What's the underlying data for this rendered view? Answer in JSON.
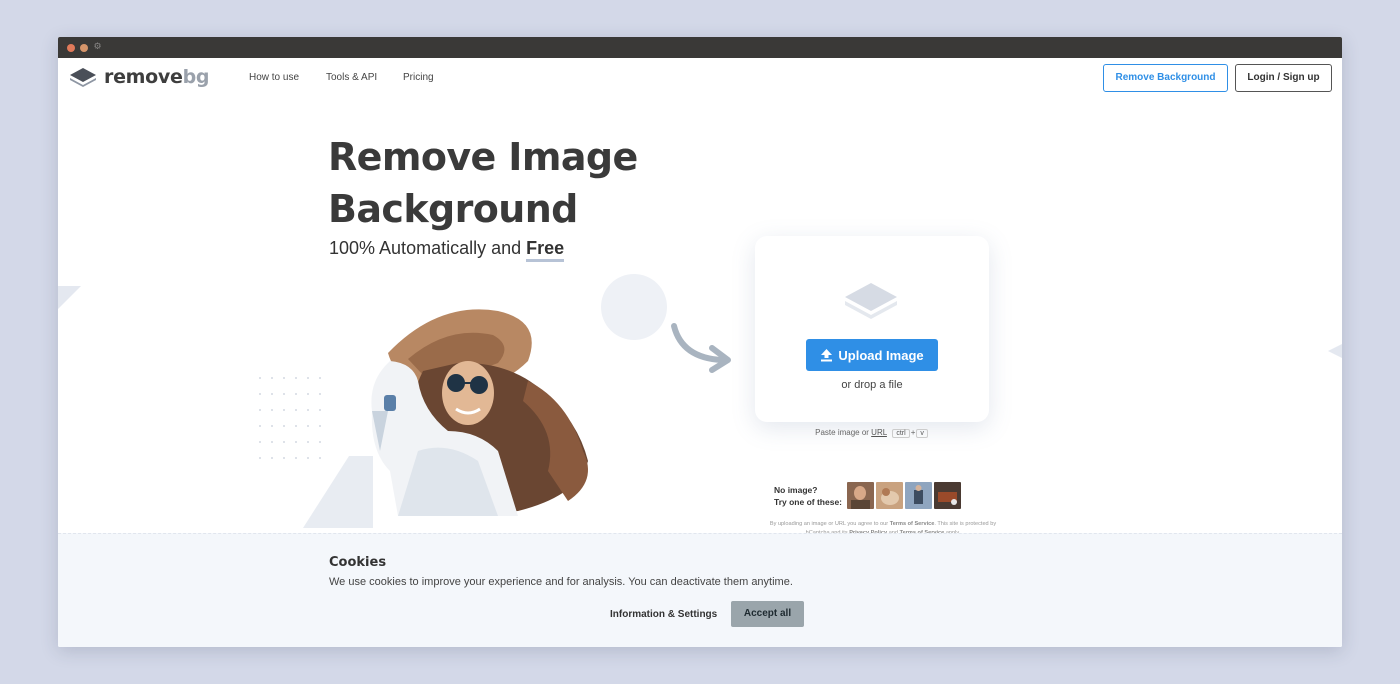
{
  "browser": {
    "close_icon": "close-dot",
    "minimize_icon": "minimize-dot",
    "settings_icon": "gear-icon"
  },
  "nav": {
    "logo_text_a": "remove",
    "logo_text_b": "bg",
    "links": [
      "How to use",
      "Tools & API",
      "Pricing"
    ],
    "remove_bg_button": "Remove Background",
    "login_button": "Login / Sign up"
  },
  "hero": {
    "title_line1": "Remove Image",
    "title_line2": "Background",
    "subtitle_prefix": "100% Automatically and ",
    "subtitle_bold": "Free"
  },
  "upload": {
    "button_label": "Upload Image",
    "drop_text": "or drop a file",
    "paste_prefix": "Paste image or ",
    "paste_url": "URL",
    "key_ctrl": "ctrl",
    "key_plus": "+",
    "key_v": "v"
  },
  "samples": {
    "line1": "No image?",
    "line2": "Try one of these:"
  },
  "legal": {
    "text1": "By uploading an image or URL you agree to our ",
    "tos": "Terms of Service",
    "text2": ". This site is protected by hCaptcha and its ",
    "privacy": "Privacy Policy",
    "text3": " and ",
    "tos2": "Terms of Service",
    "text4": " apply."
  },
  "cookies": {
    "title": "Cookies",
    "text": "We use cookies to improve your experience and for analysis. You can deactivate them anytime.",
    "info_button": "Information & Settings",
    "accept_button": "Accept all"
  },
  "colors": {
    "accent": "#2f8fe6",
    "accept_bg": "#9aa5ab"
  }
}
